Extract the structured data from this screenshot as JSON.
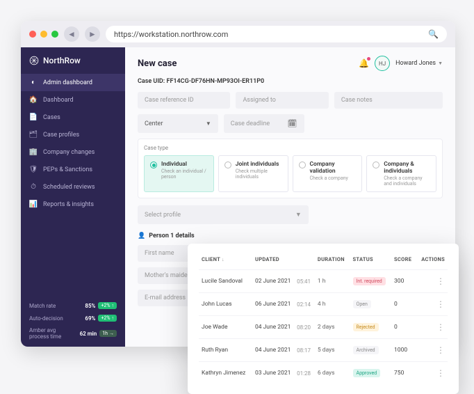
{
  "browser": {
    "url": "https://workstation.northrow.com"
  },
  "brand": "NorthRow",
  "sidebar": {
    "heading": "Admin dashboard",
    "items": [
      {
        "icon": "home",
        "label": "Dashboard"
      },
      {
        "icon": "doc",
        "label": "Cases"
      },
      {
        "icon": "profiles",
        "label": "Case profiles"
      },
      {
        "icon": "company",
        "label": "Company changes"
      },
      {
        "icon": "shield",
        "label": "PEPs & Sanctions"
      },
      {
        "icon": "clock",
        "label": "Scheduled reviews"
      },
      {
        "icon": "chart",
        "label": "Reports & insights"
      }
    ],
    "stats": [
      {
        "label": "Match rate",
        "value": "85%",
        "delta": "+2%",
        "trend": "up"
      },
      {
        "label": "Auto-decision",
        "value": "69%",
        "delta": "+2%",
        "trend": "up"
      },
      {
        "label": "Amber avg process time",
        "value": "62 min",
        "delta": "1h",
        "trend": "flat"
      }
    ]
  },
  "header": {
    "title": "New case",
    "user": {
      "initials": "HJ",
      "name": "Howard Jones"
    }
  },
  "case": {
    "uid_label": "Case UID:",
    "uid": "FF14CG-DF76HN-MP93OI-ER11P0",
    "fields": {
      "ref_placeholder": "Case reference ID",
      "assigned_placeholder": "Assigned to",
      "notes_placeholder": "Case notes",
      "center_value": "Center",
      "deadline_placeholder": "Case deadline"
    },
    "case_type_label": "Case type",
    "case_types": [
      {
        "title": "Individual",
        "sub": "Check an individual / person",
        "selected": true
      },
      {
        "title": "Joint individuals",
        "sub": "Check multiple individuals",
        "selected": false
      },
      {
        "title": "Company validation",
        "sub": "Check a company",
        "selected": false
      },
      {
        "title": "Company & individuals",
        "sub": "Check a company and individuals",
        "selected": false
      }
    ],
    "select_profile_placeholder": "Select profile",
    "person_section": "Person 1 details",
    "person_fields": {
      "first_name": "First name",
      "mother_maiden": "Mother's maiden name",
      "email": "E-mail address"
    }
  },
  "table": {
    "headers": {
      "client": "CLIENT",
      "updated": "UPDATED",
      "duration": "DURATION",
      "status": "STATUS",
      "score": "SCORE",
      "actions": "ACTIONS"
    },
    "rows": [
      {
        "client": "Lucile Sandoval",
        "date": "02 June 2021",
        "time": "05:41",
        "duration": "1 h",
        "status": "Int. required",
        "statusClass": "int",
        "score": "300"
      },
      {
        "client": "John Lucas",
        "date": "06 June 2021",
        "time": "02:14",
        "duration": "4 h",
        "status": "Open",
        "statusClass": "open",
        "score": "0"
      },
      {
        "client": "Joe Wade",
        "date": "04 June 2021",
        "time": "08:20",
        "duration": "2 days",
        "status": "Rejected",
        "statusClass": "rej",
        "score": "0"
      },
      {
        "client": "Ruth Ryan",
        "date": "04 June 2021",
        "time": "08:17",
        "duration": "5 days",
        "status": "Archived",
        "statusClass": "arch",
        "score": "1000"
      },
      {
        "client": "Kathryn Jimenez",
        "date": "03 June 2021",
        "time": "01:28",
        "duration": "6 days",
        "status": "Approved",
        "statusClass": "appr",
        "score": "750"
      }
    ]
  }
}
